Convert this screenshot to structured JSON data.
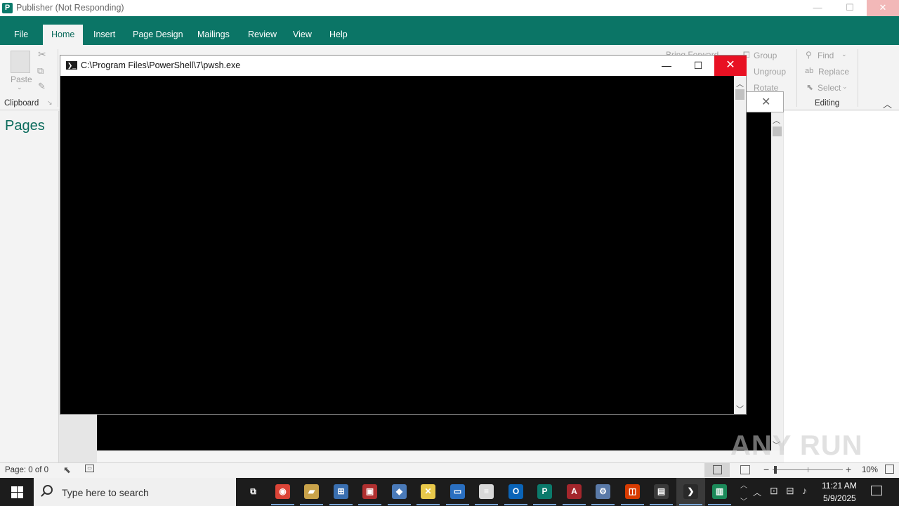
{
  "publisher": {
    "title": "Publisher (Not Responding)",
    "app_icon_letter": "P",
    "tabs": [
      "File",
      "Home",
      "Insert",
      "Page Design",
      "Mailings",
      "Review",
      "View",
      "Help"
    ],
    "active_tab": "Home",
    "ribbon": {
      "clipboard": {
        "paste_label": "Paste",
        "group_label": "Clipboard"
      },
      "bring_forward_label": "Bring Forward",
      "arrange": {
        "group_label": "Group",
        "ungroup_label": "Ungroup",
        "rotate_label": "Rotate"
      },
      "editing": {
        "find_label": "Find",
        "replace_label": "Replace",
        "select_label": "Select",
        "group_label": "Editing"
      }
    },
    "pages_pane_title": "Pages",
    "status": {
      "page_text": "Page: 0 of 0",
      "zoom_level": "10%",
      "zoom_fraction": 0.02
    }
  },
  "powershell_window": {
    "title": "C:\\Program Files\\PowerShell\\7\\pwsh.exe",
    "minimize_glyph": "—",
    "maximize_glyph": "☐",
    "close_glyph": "✕"
  },
  "watermark_text": "ANY RUN",
  "taskbar": {
    "search_placeholder": "Type here to search",
    "apps": [
      {
        "name": "task-view-icon",
        "color": "#1c1c1c",
        "glyph": "⧉"
      },
      {
        "name": "chrome-icon",
        "color": "#db4437",
        "glyph": "◉"
      },
      {
        "name": "file-manager-icon",
        "color": "#c8a24a",
        "glyph": "▰"
      },
      {
        "name": "network-tool-icon",
        "color": "#3a6fb0",
        "glyph": "⊞"
      },
      {
        "name": "media-tool-icon",
        "color": "#b03030",
        "glyph": "▣"
      },
      {
        "name": "package-icon",
        "color": "#4a7ab8",
        "glyph": "◆"
      },
      {
        "name": "exchange-icon",
        "color": "#e8c84a",
        "glyph": "✕"
      },
      {
        "name": "window-app-icon",
        "color": "#2a6fc0",
        "glyph": "▭"
      },
      {
        "name": "document-icon",
        "color": "#d8d8d8",
        "glyph": "≡"
      },
      {
        "name": "outlook-icon",
        "color": "#0a64b8",
        "glyph": "O"
      },
      {
        "name": "publisher-icon",
        "color": "#0b7a6b",
        "glyph": "P"
      },
      {
        "name": "access-icon",
        "color": "#a4262c",
        "glyph": "A"
      },
      {
        "name": "settings-tool-icon",
        "color": "#5a7aa8",
        "glyph": "⚙"
      },
      {
        "name": "office-icon",
        "color": "#d83b01",
        "glyph": "◫"
      },
      {
        "name": "terminal-window-icon",
        "color": "#3a3a3a",
        "glyph": "▤"
      },
      {
        "name": "powershell-icon",
        "color": "#2a2a2a",
        "glyph": "❯"
      },
      {
        "name": "browser-window-icon",
        "color": "#1c8a5a",
        "glyph": "▥"
      }
    ],
    "clock_time": "11:21 AM",
    "clock_date": "5/9/2025"
  }
}
